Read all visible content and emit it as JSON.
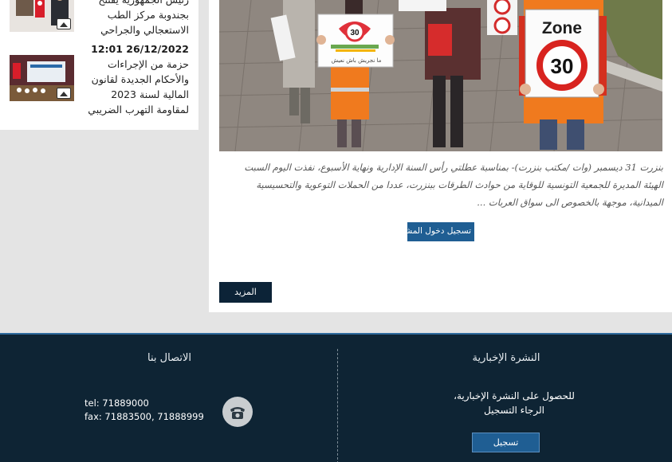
{
  "sidebar": {
    "items": [
      {
        "title": "رئيس الجمهورية يفتتح بجندوبة مركز الطب الاستعجالي والجراحي",
        "date": ""
      },
      {
        "title": "حزمة من الإجراءات والأحكام الجديدة لقانون المالية لسنة 2023 لمقاومة التهرب الضريبي",
        "date": "12:01 26/12/2022"
      }
    ]
  },
  "article": {
    "photo_signs": {
      "zone_label": "Zone",
      "speed_value": "30",
      "small_sign_value": "30",
      "small_sign_caption": "ما نجريش باش نعيش"
    },
    "excerpt": "بنزرت 31 ديسمبر (وات /مكتب بنزرت)- بمناسبة عطلتي رأس السنة الإدارية ونهاية الأسبوع، نفذت اليوم السبت الهيئة المديرة للجمعية التونسية للوقاية من حوادث الطرقات ببنزرت، عددا من الحملات التوعوية والتحسيسية الميدانية، موجهة بالخصوص الى سواق العربات ...",
    "login_label": "تسجيل دخول المشتركين",
    "more_label": "المزيد"
  },
  "footer": {
    "contact": {
      "title": "الاتصال بنا",
      "tel": "tel: 71889000",
      "fax": "fax: 71883500, 71888999"
    },
    "newsletter": {
      "title": "النشرة الإخبارية",
      "text": "للحصول على النشرة الإخبارية، الرجاء التسجيل",
      "button": "تسجيل"
    }
  },
  "colors": {
    "footer_bg": "#0e2434",
    "accent_blue": "#1f5e93",
    "more_button": "#0c2337"
  },
  "icons": {
    "thumbnail_overlay": "image-icon",
    "contact": "phone-icon"
  }
}
